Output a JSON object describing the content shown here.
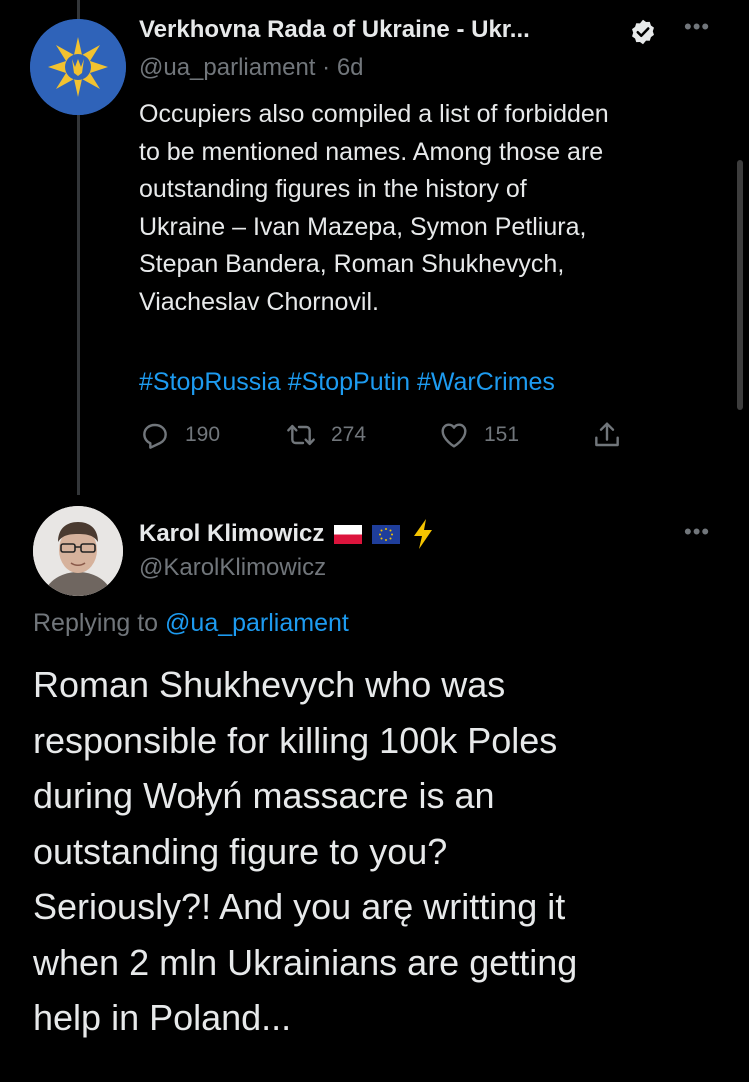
{
  "tweet1": {
    "display_name": "Verkhovna Rada of Ukraine - Ukr...",
    "handle": "@ua_parliament",
    "separator": "·",
    "time": "6d",
    "text_lines": [
      "Occupiers also compiled a list of forbidden",
      "to be mentioned names. Among those are",
      "outstanding figures in the history of",
      "Ukraine – Ivan Mazepa, Symon Petliura,",
      "Stepan Bandera, Roman Shukhevych,",
      "Viacheslav Chornovil."
    ],
    "hashtags": "#StopRussia #StopPutin #WarCrimes",
    "replies": "190",
    "retweets": "274",
    "likes": "151"
  },
  "tweet2": {
    "display_name": "Karol Klimowicz",
    "handle": "@KarolKlimowicz",
    "replying_prefix": "Replying to",
    "replying_mention": "@ua_parliament",
    "text_lines": [
      "Roman Shukhevych who was",
      "responsible for killing 100k Poles",
      "during Wołyń massacre is an",
      "outstanding figure to you?",
      "Seriously?! And you arę writting it",
      "when 2 mln Ukrainians are getting",
      "help in Poland..."
    ]
  },
  "icons": {
    "verified": "verified-badge-icon",
    "more": "more-options-icon",
    "reply": "reply-icon",
    "retweet": "retweet-icon",
    "like": "heart-icon",
    "share": "share-icon",
    "flag_pl": "poland-flag-icon",
    "flag_eu": "eu-flag-icon",
    "lightning": "lightning-icon"
  },
  "colors": {
    "background": "#000000",
    "text": "#e7e9ea",
    "secondary": "#71767b",
    "link": "#1d9bf0",
    "lightning": "#f5c400"
  }
}
